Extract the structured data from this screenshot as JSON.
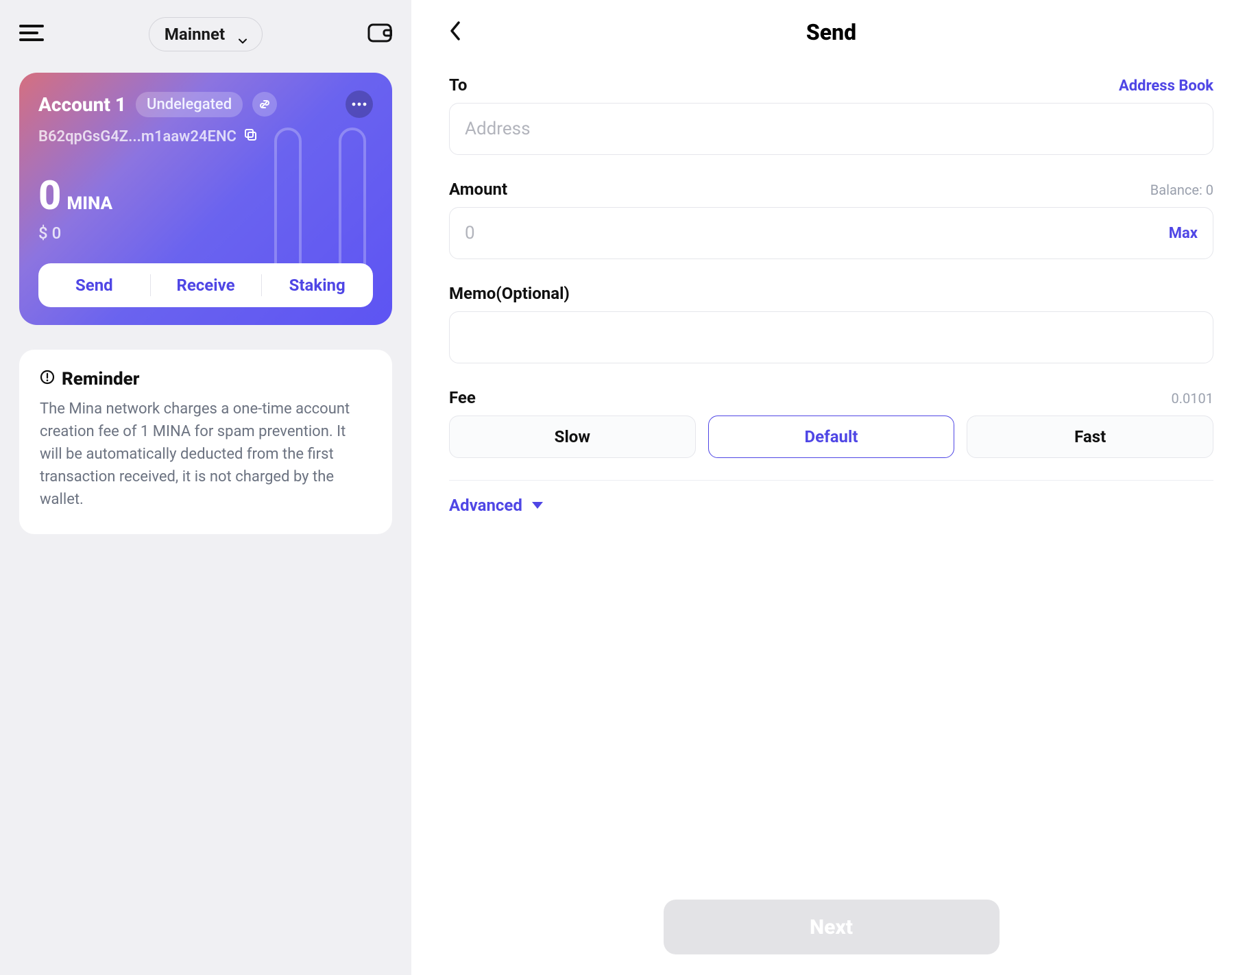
{
  "topbar": {
    "network": "Mainnet"
  },
  "account": {
    "name": "Account 1",
    "status_badge": "Undelegated",
    "address_short": "B62qpGsG4Z...m1aaw24ENC",
    "balance_num": "0",
    "balance_symbol": "MINA",
    "balance_usd": "$ 0"
  },
  "actions": {
    "send": "Send",
    "receive": "Receive",
    "staking": "Staking"
  },
  "reminder": {
    "title": "Reminder",
    "body": "The Mina network charges a one-time account creation fee of 1 MINA for spam prevention. It will be automatically deducted from the first transaction received, it is not charged by the wallet."
  },
  "send": {
    "title": "Send",
    "to_label": "To",
    "address_book": "Address Book",
    "address_placeholder": "Address",
    "amount_label": "Amount",
    "balance_label": "Balance: 0",
    "amount_placeholder": "0",
    "max_label": "Max",
    "memo_label": "Memo(Optional)",
    "fee_label": "Fee",
    "fee_value": "0.0101",
    "fee_options": {
      "slow": "Slow",
      "default": "Default",
      "fast": "Fast"
    },
    "advanced": "Advanced",
    "next": "Next"
  }
}
